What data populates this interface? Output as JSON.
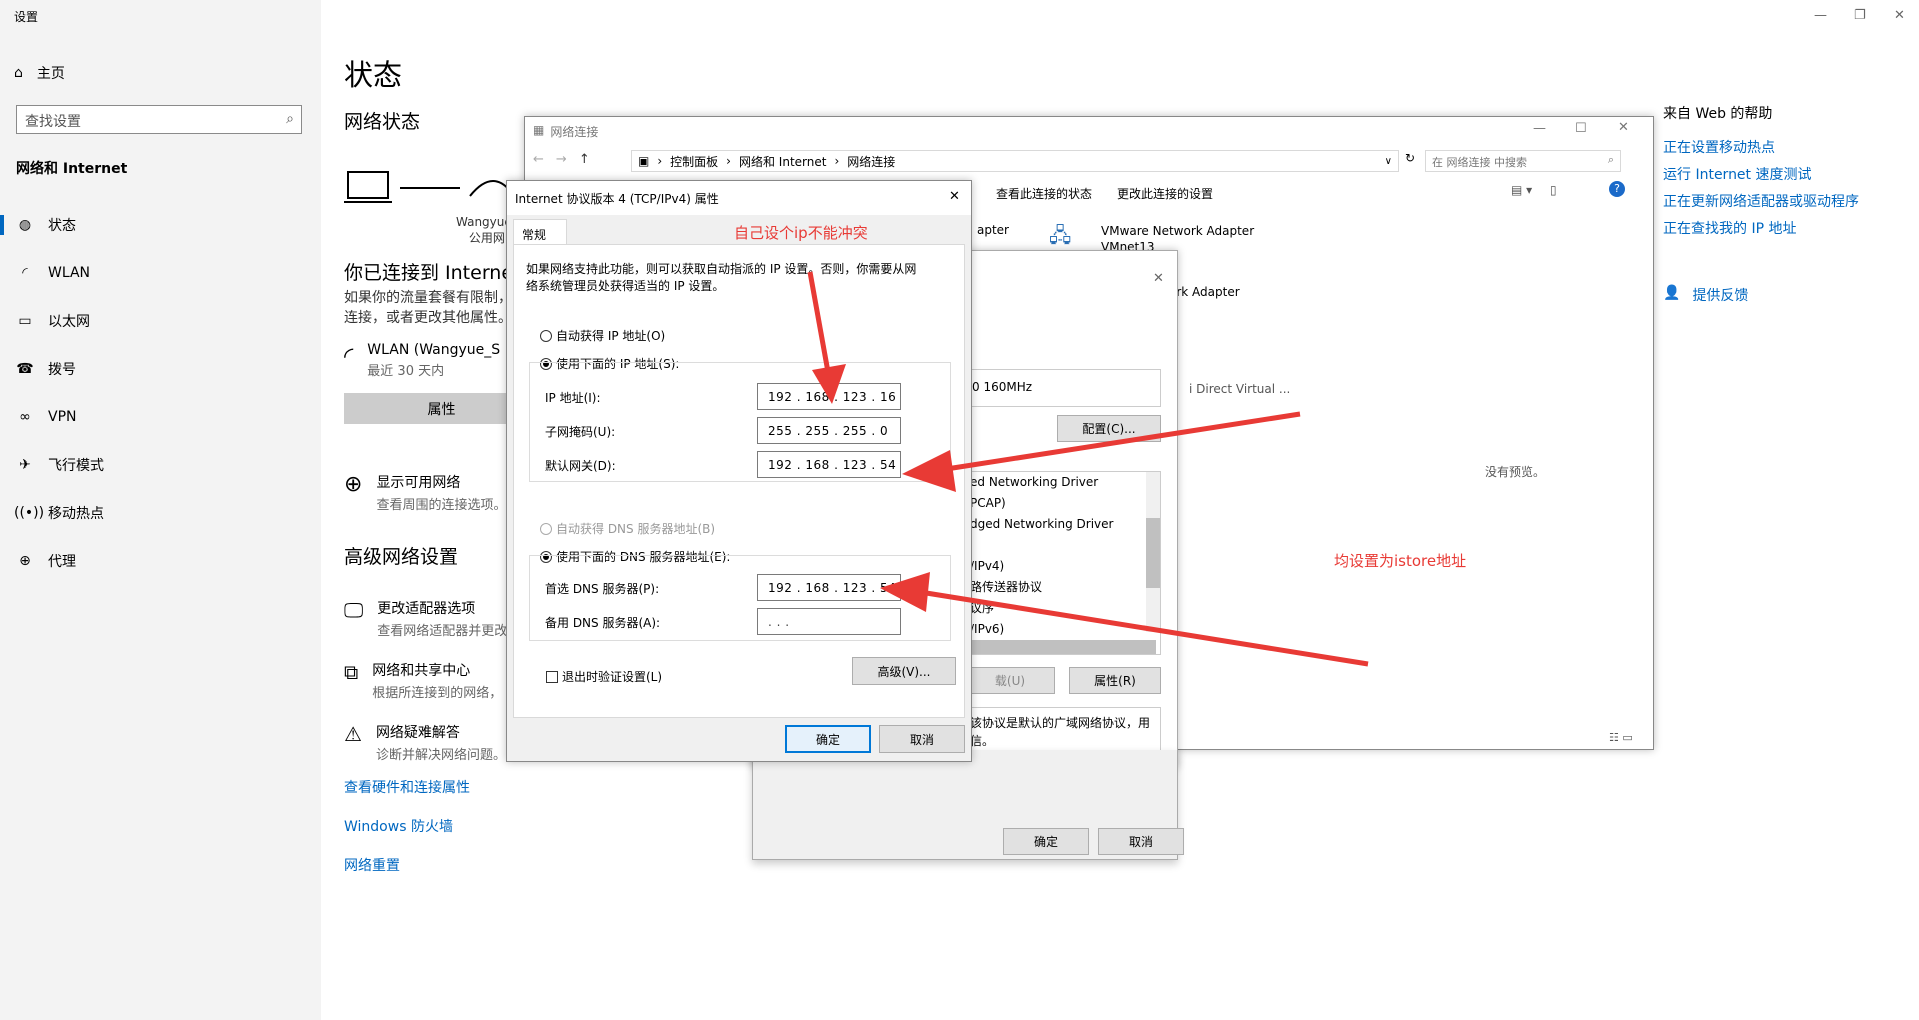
{
  "settings": {
    "title": "设置",
    "home": "主页",
    "search_placeholder": "查找设置",
    "category": "网络和 Internet",
    "nav": [
      {
        "label": "状态",
        "icon": "globe-icon"
      },
      {
        "label": "WLAN",
        "icon": "wifi-icon"
      },
      {
        "label": "以太网",
        "icon": "ethernet-icon"
      },
      {
        "label": "拨号",
        "icon": "dialup-icon"
      },
      {
        "label": "VPN",
        "icon": "vpn-icon"
      },
      {
        "label": "飞行模式",
        "icon": "airplane-icon"
      },
      {
        "label": "移动热点",
        "icon": "hotspot-icon"
      },
      {
        "label": "代理",
        "icon": "proxy-globe-icon"
      }
    ],
    "page_title": "状态",
    "network_status": "网络状态",
    "device_name": "Wangyue_",
    "device_type": "公用网",
    "connected": "你已连接到 Internet",
    "connected_desc_1": "如果你的流量套餐有限制，",
    "connected_desc_2": "连接，或者更改其他属性。",
    "wlan_name": "WLAN (Wangyue_S",
    "wlan_usage": "最近 30 天内",
    "properties_button": "属性",
    "show_networks": "显示可用网络",
    "show_networks_desc": "查看周围的连接选项。",
    "advanced_title": "高级网络设置",
    "adapter_options": "更改适配器选项",
    "adapter_options_desc": "查看网络适配器并更改",
    "sharing_center": "网络和共享中心",
    "sharing_center_desc": "根据所连接到的网络，",
    "troubleshoot": "网络疑难解答",
    "troubleshoot_desc": "诊断并解决网络问题。",
    "link_hardware": "查看硬件和连接属性",
    "link_firewall": "Windows 防火墙",
    "link_reset": "网络重置",
    "help_title": "来自 Web 的帮助",
    "help_links": [
      "正在设置移动热点",
      "运行 Internet 速度测试",
      "正在更新网络适配器或驱动程序",
      "正在查找我的 IP 地址"
    ],
    "feedback": "提供反馈"
  },
  "netconn": {
    "title": "网络连接",
    "breadcrumb": [
      "控制面板",
      "网络和 Internet",
      "网络连接"
    ],
    "search_placeholder": "在 网络连接 中搜索",
    "cmd_status": "查看此连接的状态",
    "cmd_change": "更改此连接的设置",
    "adapter_partial": "apter",
    "vmware_name": "VMware Network Adapter",
    "vmware_sub": "VMnet13",
    "adapter2_partial": "ork Adapter",
    "wifi_direct_partial": "i Direct Virtual ...",
    "no_preview": "没有预览。"
  },
  "wlanprops": {
    "speed": "0 160MHz",
    "configure": "配置(C)...",
    "items": [
      "ed Networking Driver",
      "PCAP)",
      "dged Networking Driver",
      "",
      "/IPv4)",
      "路传送器协议",
      "议序",
      "/IPv6)"
    ],
    "uninstall": "载(U)",
    "properties": "属性(R)",
    "desc_1": "该协议是默认的广域网络协议，用",
    "desc_2": "信。",
    "ok": "确定",
    "cancel": "取消"
  },
  "ipv4": {
    "title": "Internet 协议版本 4 (TCP/IPv4) 属性",
    "tab": "常规",
    "intro_1": "如果网络支持此功能，则可以获取自动指派的 IP 设置。否则，你需要从网",
    "intro_2": "络系统管理员处获得适当的 IP 设置。",
    "auto_ip": "自动获得 IP 地址(O)",
    "manual_ip": "使用下面的 IP 地址(S):",
    "ip_label": "IP 地址(I):",
    "ip_value": "192 . 168 . 123 .  16",
    "mask_label": "子网掩码(U):",
    "mask_value": "255 . 255 . 255 .   0",
    "gw_label": "默认网关(D):",
    "gw_value": "192 . 168 . 123 .  54",
    "auto_dns": "自动获得 DNS 服务器地址(B)",
    "manual_dns": "使用下面的 DNS 服务器地址(E):",
    "dns1_label": "首选 DNS 服务器(P):",
    "dns1_value": "192 . 168 . 123 .  54",
    "dns2_label": "备用 DNS 服务器(A):",
    "dns2_value": "  .      .      .",
    "validate": "退出时验证设置(L)",
    "advanced": "高级(V)...",
    "ok": "确定",
    "cancel": "取消"
  },
  "annotations": {
    "ip_note": "自己设个ip不能冲突",
    "istore_note": "均设置为istore地址",
    "color": "#e83a35"
  }
}
